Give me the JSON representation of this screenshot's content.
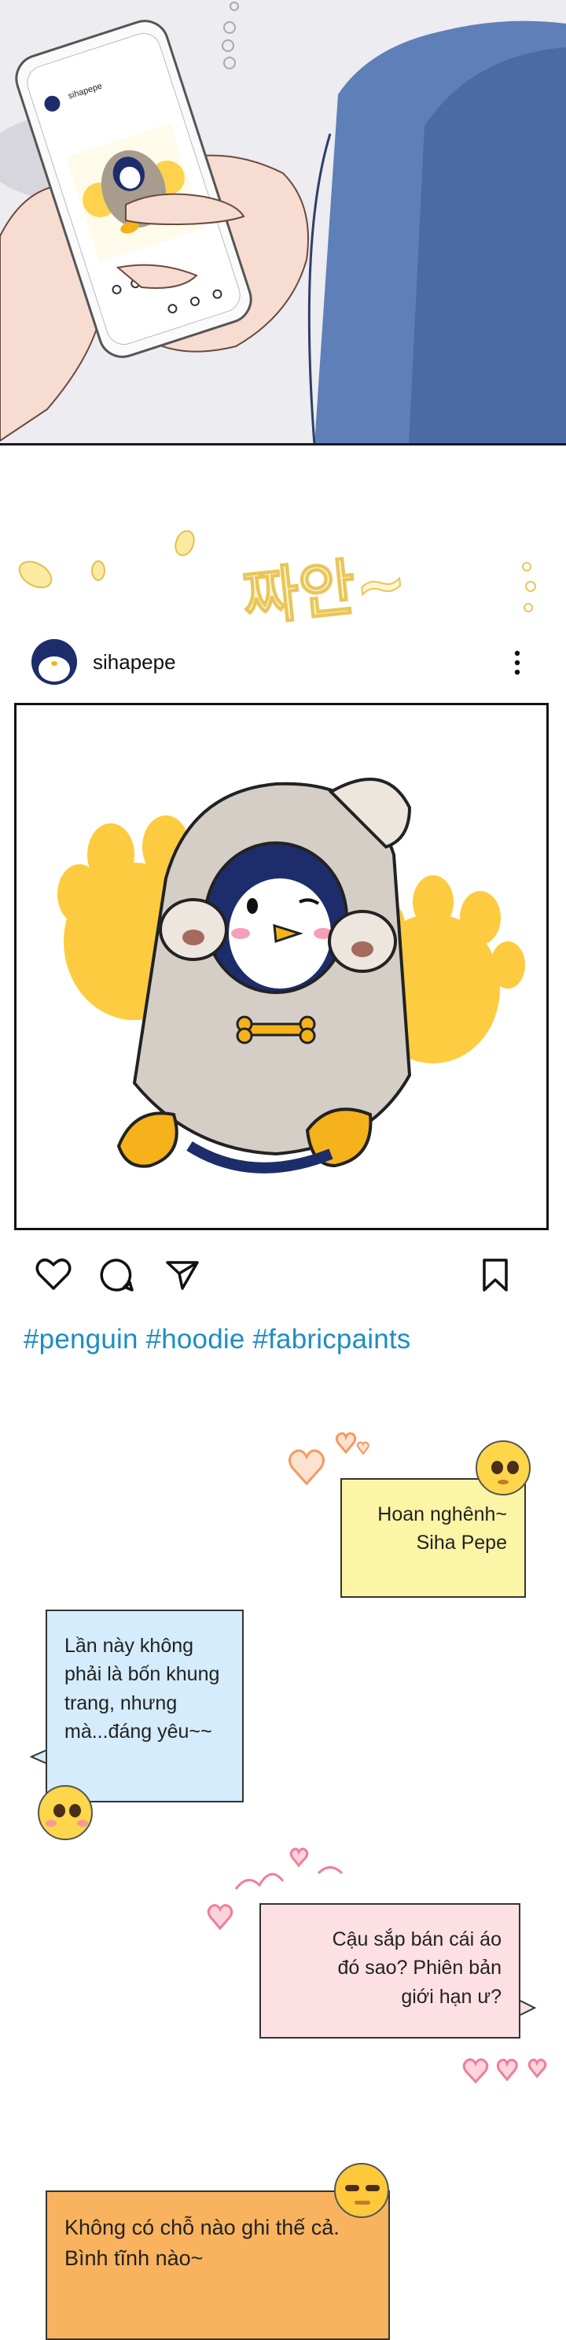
{
  "post": {
    "username": "sihapepe",
    "hashtags": "#penguin #hoodie #fabricpaints"
  },
  "phone_screen": {
    "username": "sihapepe"
  },
  "korean_sfx": "짜안~",
  "bubbles": {
    "greeting": [
      "Hoan nghênh~",
      "Siha Pepe"
    ],
    "reply1": [
      "Lần này không",
      "phải là bốn khung",
      "trang, nhưng",
      "mà...đáng yêu~~"
    ],
    "question": [
      "Cậu sắp bán cái áo",
      "đó sao? Phiên bản",
      "giới hạn ư?"
    ],
    "answer": [
      "Không có chỗ nào ghi thế cả.",
      "Bình tĩnh nào~"
    ]
  },
  "colors": {
    "hashtag": "#1e8cc6",
    "bubble_yellow": "#fdf5a6",
    "bubble_blue": "#d4ecfb",
    "bubble_pink": "#fde0e3",
    "bubble_orange": "#f9b35e"
  },
  "icons": [
    "heart-icon",
    "comment-icon",
    "share-icon",
    "bookmark-icon",
    "more-options-icon"
  ]
}
